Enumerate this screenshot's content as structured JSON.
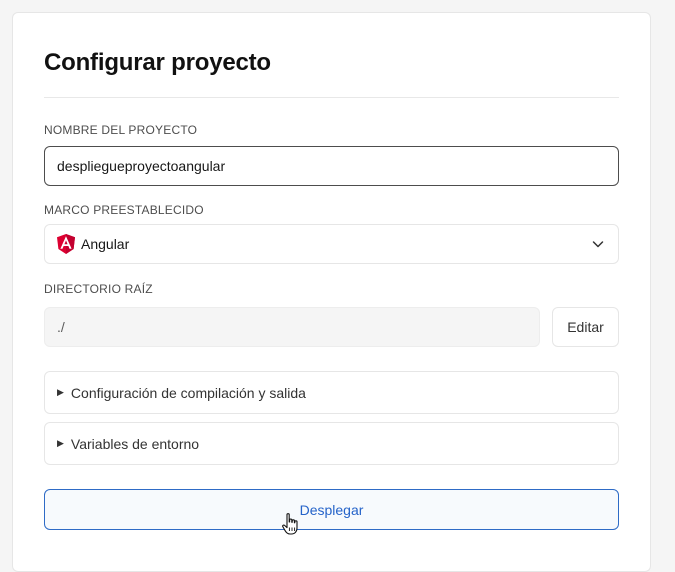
{
  "form": {
    "title": "Configurar proyecto",
    "project_name": {
      "label": "NOMBRE DEL PROYECTO",
      "value": "desplieguepro­yectoangular"
    },
    "framework": {
      "label": "MARCO PREESTABLECIDO",
      "selected": "Angular",
      "icon": "angular-logo-icon"
    },
    "root_dir": {
      "label": "DIRECTORIO RAÍZ",
      "value": "./",
      "edit_label": "Editar"
    },
    "sections": [
      {
        "label": "Configuración de compilación y salida"
      },
      {
        "label": "Variables de entorno"
      }
    ],
    "deploy_label": "Desplegar"
  },
  "colors": {
    "accent": "#2563c9",
    "angular_red": "#dd0031"
  }
}
